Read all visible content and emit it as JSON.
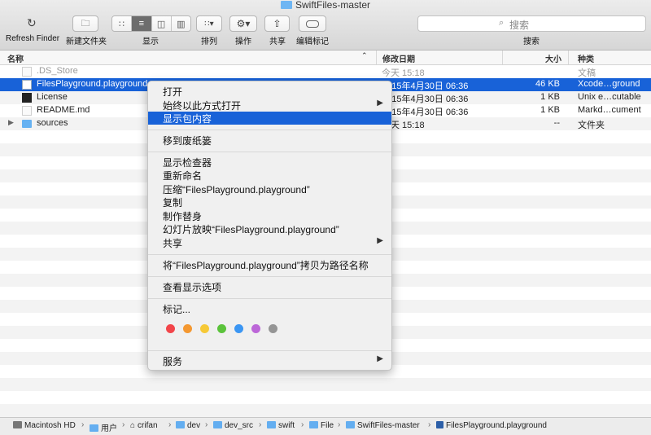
{
  "window": {
    "title": "SwiftFiles-master"
  },
  "toolbar": {
    "back_label": "Refresh Finder",
    "newfolder_label": "新建文件夹",
    "view_label": "显示",
    "arrange_label": "排列",
    "action_label": "操作",
    "share_label": "共享",
    "tags_label": "编辑标记",
    "search_placeholder": "搜索",
    "search_label": "搜索"
  },
  "columns": {
    "name": "名称",
    "date": "修改日期",
    "size": "大小",
    "kind": "种类"
  },
  "files": [
    {
      "name": ".DS_Store",
      "date": "今天 15:18",
      "size": "",
      "kind": "文稿"
    },
    {
      "name": "FilesPlayground.playground",
      "date": "2015年4月30日 06:36",
      "size": "46 KB",
      "kind": "Xcode…ground"
    },
    {
      "name": "License",
      "date": "2015年4月30日 06:36",
      "size": "1 KB",
      "kind": "Unix e…cutable"
    },
    {
      "name": "README.md",
      "date": "2015年4月30日 06:36",
      "size": "1 KB",
      "kind": "Markd…cument"
    },
    {
      "name": "sources",
      "date": "今天 15:18",
      "size": "--",
      "kind": "文件夹"
    }
  ],
  "context_menu": {
    "open": "打开",
    "open_with": "始终以此方式打开",
    "show_package": "显示包内容",
    "trash": "移到废纸篓",
    "get_info": "显示检查器",
    "rename": "重新命名",
    "compress": "压缩“FilesPlayground.playground”",
    "duplicate": "复制",
    "alias": "制作替身",
    "slideshow": "幻灯片放映“FilesPlayground.playground”",
    "share": "共享",
    "copy_path": "将“FilesPlayground.playground”拷贝为路径名称",
    "view_options": "查看显示选项",
    "tags": "标记...",
    "services": "服务",
    "tag_colors": [
      "#f2454a",
      "#f49831",
      "#f6c937",
      "#5bc33b",
      "#3b96f3",
      "#bc67d8",
      "#959595"
    ]
  },
  "pathbar": [
    "Macintosh HD",
    "用户",
    "crifan",
    "dev",
    "dev_src",
    "swift",
    "File",
    "SwiftFiles-master",
    "FilesPlayground.playground"
  ]
}
